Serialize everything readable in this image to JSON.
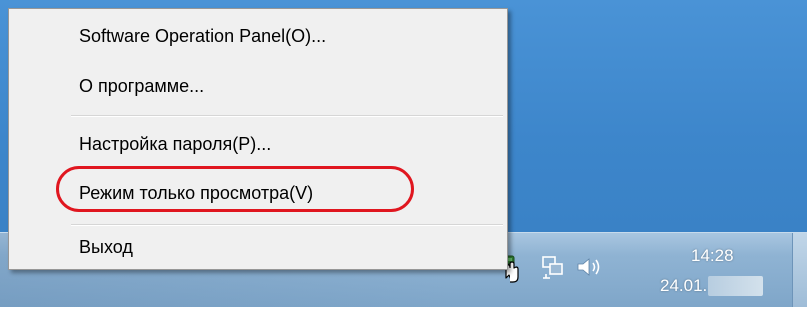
{
  "context_menu": {
    "items": [
      {
        "label": "Software Operation Panel(O)..."
      },
      {
        "label": "О программе..."
      },
      {
        "label": "Настройка пароля(P)..."
      },
      {
        "label": "Режим только просмотра(V)"
      },
      {
        "label": "Выход"
      }
    ],
    "highlighted_item_index": 3,
    "highlight_color": "#e0161f"
  },
  "taskbar": {
    "clock": {
      "time": "14:28",
      "date": "24.01."
    },
    "tray_icons": [
      "show-hidden-icons-arrow-icon",
      "scanner-status-icon",
      "network-icon",
      "volume-icon"
    ]
  },
  "colors": {
    "desktop": "#3d86cb",
    "taskbar": "#8fb3d3",
    "menu_background": "#f0f0f0"
  }
}
